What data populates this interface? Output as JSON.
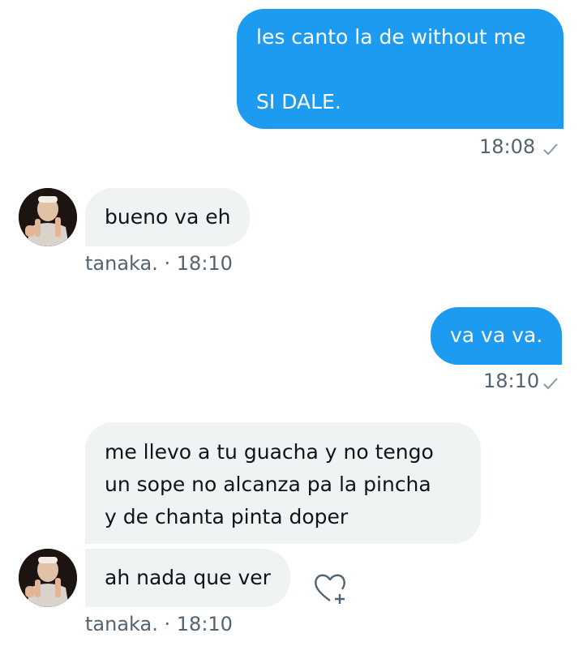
{
  "messages": [
    {
      "id": "m1",
      "direction": "out",
      "lines": [
        "les canto la de without me",
        "",
        "SI DALE."
      ],
      "time": "18:08"
    },
    {
      "id": "m2",
      "direction": "in",
      "text": "bueno va eh",
      "sender": "tanaka.",
      "separator": "·",
      "time": "18:10"
    },
    {
      "id": "m3",
      "direction": "out",
      "text": "va va va.",
      "time": "18:10"
    },
    {
      "id": "m4",
      "direction": "in",
      "lines": [
        "me llevo a tu guacha y no tengo",
        "un sope no alcanza pa la pincha",
        "y de chanta pinta doper"
      ]
    },
    {
      "id": "m5",
      "direction": "in",
      "text": "ah nada que ver",
      "sender": "tanaka.",
      "separator": "·",
      "time": "18:10"
    }
  ],
  "icons": {
    "sent_check": "check-icon",
    "react": "heart-plus-icon",
    "avatar": "avatar"
  },
  "colors": {
    "outgoing_bubble": "#1d9bf0",
    "incoming_bubble": "#eff3f4",
    "meta_text": "#536471"
  }
}
